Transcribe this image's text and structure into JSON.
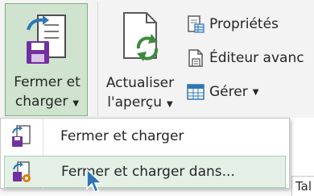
{
  "ribbon": {
    "close_load": {
      "line1": "Fermer et",
      "line2": "charger",
      "icon": "close-and-load-icon"
    },
    "refresh": {
      "line1": "Actualiser",
      "line2": "l'aperçu",
      "icon": "refresh-icon"
    },
    "properties": {
      "label": "Propriétés",
      "icon": "properties-icon"
    },
    "advanced_editor": {
      "label": "Éditeur avanc",
      "icon": "advanced-editor-icon"
    },
    "manage": {
      "label": "Gérer",
      "icon": "manage-icon"
    }
  },
  "menu": {
    "items": [
      {
        "label": "Fermer et charger",
        "icon": "close-and-load-icon"
      },
      {
        "label": "Fermer et charger dans...",
        "icon": "close-and-load-to-icon"
      }
    ]
  },
  "background": {
    "tab_partial": "Tal"
  },
  "colors": {
    "accent": "#2e75b6",
    "active_bg": "#cfe3cf",
    "hover_bg": "#e4efe6"
  }
}
